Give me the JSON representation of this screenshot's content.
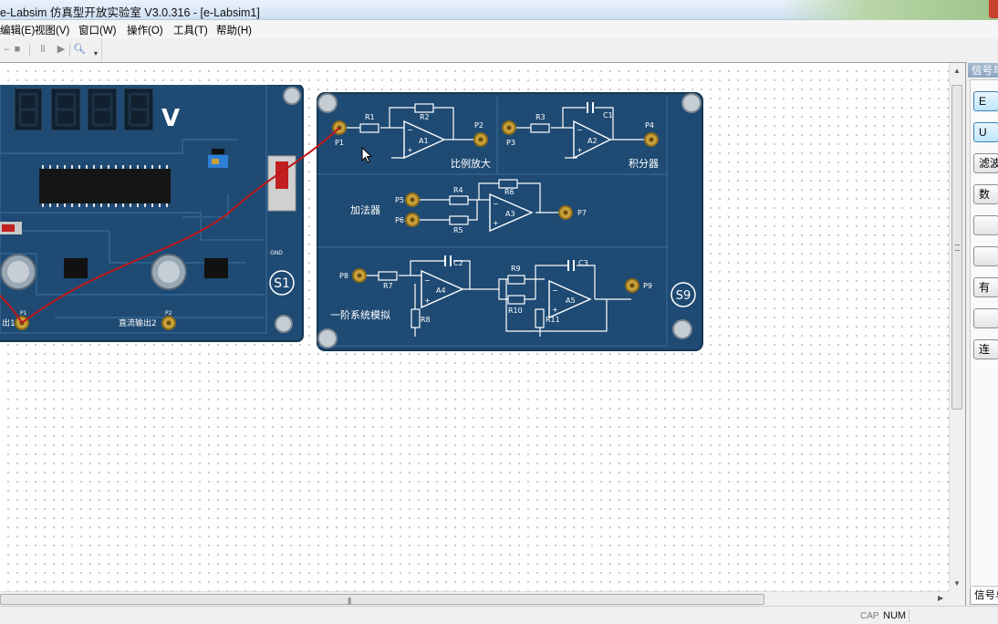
{
  "window": {
    "title": "e-Labsim 仿真型开放实验室 V3.0.316 - [e-Labsim1]"
  },
  "menu": {
    "items": [
      "编辑(E)",
      "视图(V)",
      "窗口(W)",
      "操作(O)",
      "工具(T)",
      "帮助(H)"
    ]
  },
  "toolbar": {
    "icons": [
      "stop-icon",
      "pause-icon",
      "play-icon",
      "zoom-icon",
      "dropdown-icon"
    ]
  },
  "board_s1": {
    "unit_label": "V",
    "id_label": "S1",
    "output1_label": "出1",
    "output2_label": "直流输出2",
    "pin_p1": "P1",
    "pin_p2": "P2",
    "gnd_label": "GND"
  },
  "board_s9": {
    "id_label": "S9",
    "section_proportional": "比例放大",
    "section_integrator": "积分器",
    "section_adder": "加法器",
    "section_first_order": "一阶系统模拟",
    "pins": {
      "p1": "P1",
      "p2": "P2",
      "p3": "P3",
      "p4": "P4",
      "p5": "P5",
      "p6": "P6",
      "p7": "P7",
      "p8": "P8",
      "p9": "P9"
    },
    "resistors": {
      "r1": "R1",
      "r2": "R2",
      "r3": "R3",
      "r4": "R4",
      "r5": "R5",
      "r6": "R6",
      "r7": "R7",
      "r8": "R8",
      "r9": "R9",
      "r10": "R10",
      "r11": "R11"
    },
    "capacitors": {
      "c1": "C1",
      "c2": "C2",
      "c3": "C3"
    },
    "amps": {
      "a1": "A1",
      "a2": "A2",
      "a3": "A3",
      "a4": "A4",
      "a5": "A5"
    }
  },
  "right_panel": {
    "header": "信号与",
    "buttons": [
      "E",
      "U",
      "滤波",
      "数",
      "",
      "",
      "有",
      "",
      "连"
    ],
    "tab": "信号与"
  },
  "status": {
    "cap": "CAP",
    "num": "NUM"
  },
  "colors": {
    "board_blue": "#1e4a73",
    "trace_blue": "#2c5f8c",
    "wire_red": "#c01818",
    "pin_gold": "#c9a13a"
  }
}
